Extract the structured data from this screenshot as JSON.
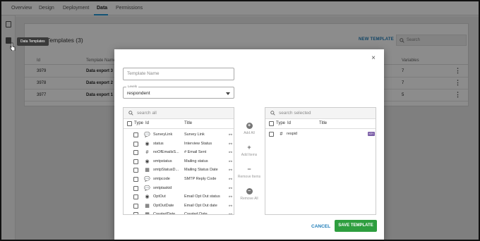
{
  "tabs": [
    "Overview",
    "Design",
    "Deployment",
    "Data",
    "Permissions"
  ],
  "tooltip": "Data Templates",
  "card": {
    "title": "Data Templates (3)",
    "new_template": "NEW TEMPLATE",
    "search_placeholder": "Search",
    "headers": {
      "id": "Id",
      "name": "Template Name",
      "variables": "Variables"
    },
    "rows": [
      {
        "id": "3979",
        "name": "Data export 3",
        "variables": "7"
      },
      {
        "id": "3978",
        "name": "Data export 2",
        "variables": "7"
      },
      {
        "id": "3977",
        "name": "Data export 1",
        "variables": "5"
      }
    ]
  },
  "modal": {
    "close": "×",
    "template_name_placeholder": "Template Name",
    "select_label": "Levels",
    "select_value": "respondent",
    "left_search_placeholder": "search all",
    "right_search_placeholder": "search selected",
    "col_type": "Type",
    "col_id": "Id",
    "col_title": "Title",
    "available": [
      {
        "icon": "💬",
        "id": "SurveyLink",
        "title": "Survey Link"
      },
      {
        "icon": "◉",
        "id": "status",
        "title": "Interview Status"
      },
      {
        "icon": "#",
        "id": "noOfEmailsS...",
        "title": "# Email Sent"
      },
      {
        "icon": "◉",
        "id": "smtpstatus",
        "title": "Mailing status"
      },
      {
        "icon": "▦",
        "id": "smtpStatusD...",
        "title": "Mailing Status Date"
      },
      {
        "icon": "💬",
        "id": "smtpcode",
        "title": "SMTP Reply Code"
      },
      {
        "icon": "💬",
        "id": "smtptaskid",
        "title": ""
      },
      {
        "icon": "◉",
        "id": "OptOut",
        "title": "Email Opt Out status"
      },
      {
        "icon": "▦",
        "id": "OptOutDate",
        "title": "Email Opt Out date"
      },
      {
        "icon": "▦",
        "id": "CreatedDate",
        "title": "Created Date"
      }
    ],
    "selected": [
      {
        "icon": "#",
        "id": "respid",
        "title": "",
        "badge": "KEY"
      }
    ],
    "actions": {
      "add_all": "Add All",
      "add_items": "Add Items",
      "remove_items": "Remove Items",
      "remove_all": "Remove All"
    },
    "cancel": "CANCEL",
    "save": "SAVE TEMPLATE"
  },
  "colors": {
    "accent": "#2196d3",
    "save": "#2e9e3f",
    "badge": "#7b5ea7"
  }
}
